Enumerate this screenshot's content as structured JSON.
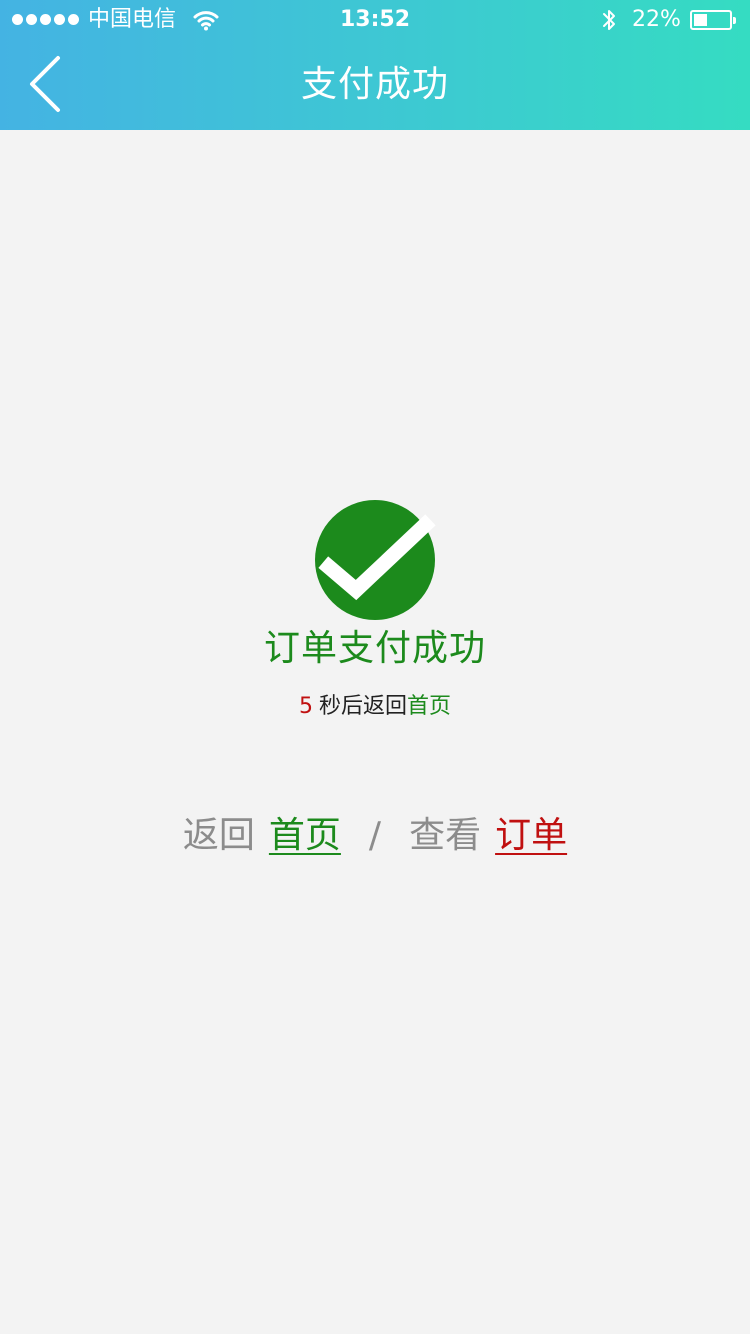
{
  "status_bar": {
    "carrier": "中国电信",
    "time": "13:52",
    "battery_percent": "22%",
    "battery_level": 0.22,
    "icons": [
      "signal-dots-icon",
      "wifi-icon",
      "bluetooth-icon",
      "battery-icon"
    ]
  },
  "nav": {
    "title": "支付成功",
    "back_icon": "chevron-left-icon"
  },
  "result": {
    "icon": "checkmark-circle-icon",
    "title": "订单支付成功",
    "countdown_number": "5",
    "countdown_text": "秒后返回",
    "countdown_link": "首页"
  },
  "actions": {
    "back_label": "返回",
    "home_link": "首页",
    "separator": "/",
    "view_label": "查看",
    "order_link": "订单"
  },
  "colors": {
    "header_gradient_start": "#44b3e3",
    "header_gradient_end": "#35dcc2",
    "success_green": "#1c8a1c",
    "accent_red": "#c01010",
    "muted_gray": "#8c8c8c",
    "background": "#f3f3f3"
  }
}
